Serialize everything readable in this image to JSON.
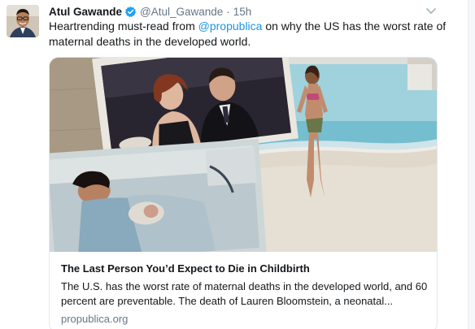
{
  "tweet": {
    "author_name": "Atul Gawande",
    "handle": "@Atul_Gawande",
    "separator": "·",
    "time": "15h",
    "text_before": "Heartrending must-read from ",
    "mention": "@propublica",
    "text_after": " on why the US has the worst rate of maternal deaths in the developed world."
  },
  "card": {
    "title": "The Last Person You’d Expect to Die in Childbirth",
    "description": "The U.S. has the worst rate of maternal deaths in the developed world, and 60 percent are preventable. The death of Lauren Bloomstein, a neonatal...",
    "domain": "propublica.org"
  },
  "colors": {
    "link": "#1b95e0",
    "verified": "#1da1f2",
    "muted": "#657786",
    "border": "#e1e8ed"
  },
  "icons": [
    "verified-badge-icon",
    "chevron-down-icon"
  ]
}
